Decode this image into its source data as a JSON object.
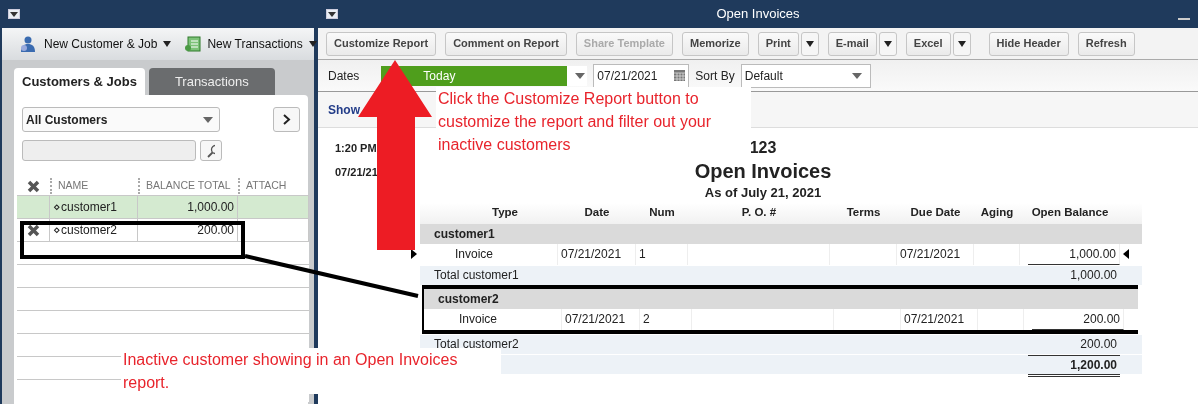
{
  "customer_center": {
    "toolbar": [
      {
        "label": "New Customer & Job",
        "kind": "customer"
      },
      {
        "label": "New Transactions",
        "kind": "transaction"
      }
    ],
    "tabs": [
      {
        "label": "Customers & Jobs",
        "selected": true
      },
      {
        "label": "Transactions",
        "selected": false
      }
    ],
    "filter": {
      "value": "All Customers"
    },
    "columns": [
      "NAME",
      "BALANCE TOTAL",
      "ATTACH"
    ],
    "rows": [
      {
        "name": "⋄customer1",
        "balance": "1,000.00",
        "inactive": false,
        "selected": true
      },
      {
        "name": "⋄customer2",
        "balance": "200.00",
        "inactive": true,
        "selected": false
      }
    ]
  },
  "report_window": {
    "title": "Open Invoices",
    "toolbar": [
      {
        "label": "Customize Report",
        "disabled": false,
        "dropdown": false
      },
      {
        "label": "Comment on Report",
        "disabled": false,
        "dropdown": false
      },
      {
        "label": "Share Template",
        "disabled": true,
        "dropdown": false
      },
      {
        "label": "Memorize",
        "disabled": false,
        "dropdown": false
      },
      {
        "label": "Print",
        "disabled": false,
        "dropdown": true
      },
      {
        "label": "E-mail",
        "disabled": false,
        "dropdown": true
      },
      {
        "label": "Excel",
        "disabled": false,
        "dropdown": true
      },
      {
        "label": "Hide Header",
        "disabled": false,
        "dropdown": false
      },
      {
        "label": "Refresh",
        "disabled": false,
        "dropdown": false
      }
    ],
    "dates": {
      "label": "Dates",
      "value": "Today",
      "date": "07/21/2021"
    },
    "sort_by": {
      "label": "Sort By",
      "value": "Default"
    },
    "show_label": "Show",
    "header": {
      "time": "1:20 PM",
      "date": "07/21/21",
      "company": "123",
      "title": "Open Invoices",
      "subtitle": "As of July 21, 2021"
    },
    "table": {
      "columns": [
        "Type",
        "Date",
        "Num",
        "P. O. #",
        "Terms",
        "Due Date",
        "Aging",
        "Open Balance"
      ],
      "rows": [
        {
          "kind": "group",
          "label": "customer1"
        },
        {
          "kind": "line",
          "type": "Invoice",
          "date": "07/21/2021",
          "num": "1",
          "due_date": "07/21/2021",
          "open_balance": "1,000.00",
          "selected": true
        },
        {
          "kind": "total",
          "label": "Total customer1",
          "open_balance": "1,000.00"
        },
        {
          "kind": "group",
          "label": "customer2"
        },
        {
          "kind": "line",
          "type": "Invoice",
          "date": "07/21/2021",
          "num": "2",
          "due_date": "07/21/2021",
          "open_balance": "200.00",
          "selected": false
        },
        {
          "kind": "total",
          "label": "Total customer2",
          "open_balance": "200.00"
        },
        {
          "kind": "grand_total",
          "open_balance": "1,200.00"
        }
      ]
    }
  },
  "callouts": [
    {
      "text": "Click the Customize Report button to customize the report and filter out your inactive customers"
    },
    {
      "text": "Inactive customer showing in an Open Invoices report."
    }
  ]
}
